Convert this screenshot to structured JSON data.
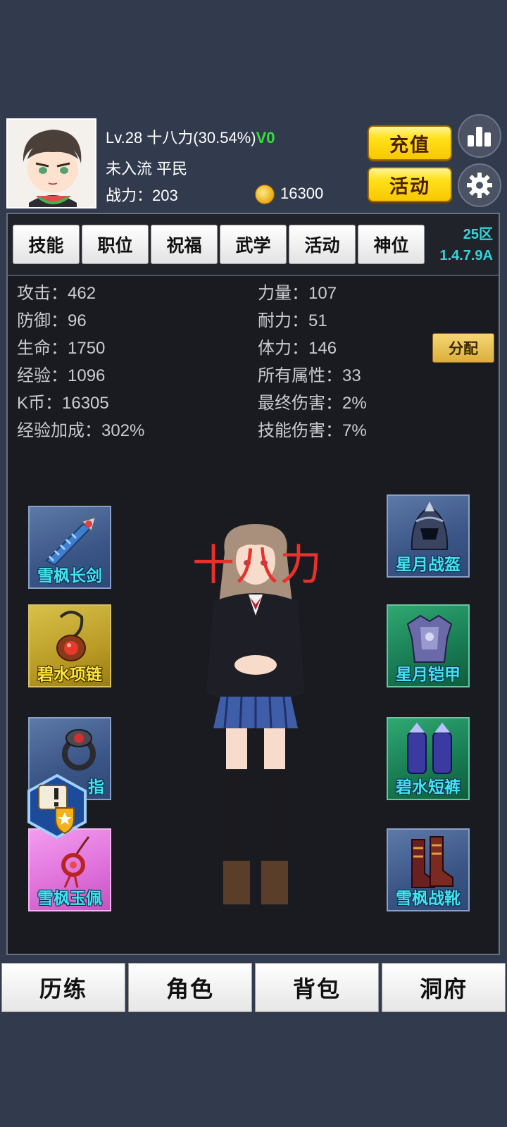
{
  "player": {
    "level_line": "Lv.28 十八力(30.54%)",
    "vip": "V0",
    "rank_line": "未入流  平民",
    "power_label": "战力：",
    "power_value": "203",
    "coins": "16300"
  },
  "buttons": {
    "recharge": "充值",
    "activity": "活动",
    "stats_icon": "bar-chart-icon",
    "settings_icon": "gear-icon"
  },
  "tabs": [
    "技能",
    "职位",
    "祝福",
    "武学",
    "活动",
    "神位"
  ],
  "server": {
    "zone": "25区",
    "version": "1.4.7.9A"
  },
  "stats_left": [
    {
      "label": "攻击：",
      "value": "462"
    },
    {
      "label": "防御：",
      "value": "96"
    },
    {
      "label": "生命：",
      "value": "1750"
    },
    {
      "label": "经验：",
      "value": "1096"
    },
    {
      "label": "K币：",
      "value": "16305"
    },
    {
      "label": "经验加成：",
      "value": "302%"
    }
  ],
  "stats_right": [
    {
      "label": "力量：",
      "value": "107"
    },
    {
      "label": "耐力：",
      "value": "51"
    },
    {
      "label": "体力：",
      "value": "146"
    },
    {
      "label": "所有属性：",
      "value": "33"
    },
    {
      "label": "最终伤害：",
      "value": "2%"
    },
    {
      "label": "技能伤害：",
      "value": "7%"
    }
  ],
  "distribute_label": "分配",
  "character_name": "十八力",
  "equipment_left": [
    {
      "name": "雪枫长剑",
      "icon": "sword-icon"
    },
    {
      "name": "碧水项链",
      "icon": "necklace-icon"
    },
    {
      "name": "指",
      "icon": "ring-icon"
    },
    {
      "name": "雪枫玉佩",
      "icon": "pendant-icon"
    }
  ],
  "equipment_right": [
    {
      "name": "星月战盔",
      "icon": "helmet-icon"
    },
    {
      "name": "星月铠甲",
      "icon": "armor-icon"
    },
    {
      "name": "碧水短裤",
      "icon": "leggings-icon"
    },
    {
      "name": "雪枫战靴",
      "icon": "boots-icon"
    }
  ],
  "bottom_nav": [
    "历练",
    "角色",
    "背包",
    "洞府"
  ],
  "colors": {
    "background": "#323a4d",
    "panel": "#1a1b20",
    "accent_cyan": "#31d6d9",
    "gold_button": "#ffe11b",
    "vip_green": "#36e03a",
    "name_red": "#e9312c"
  }
}
